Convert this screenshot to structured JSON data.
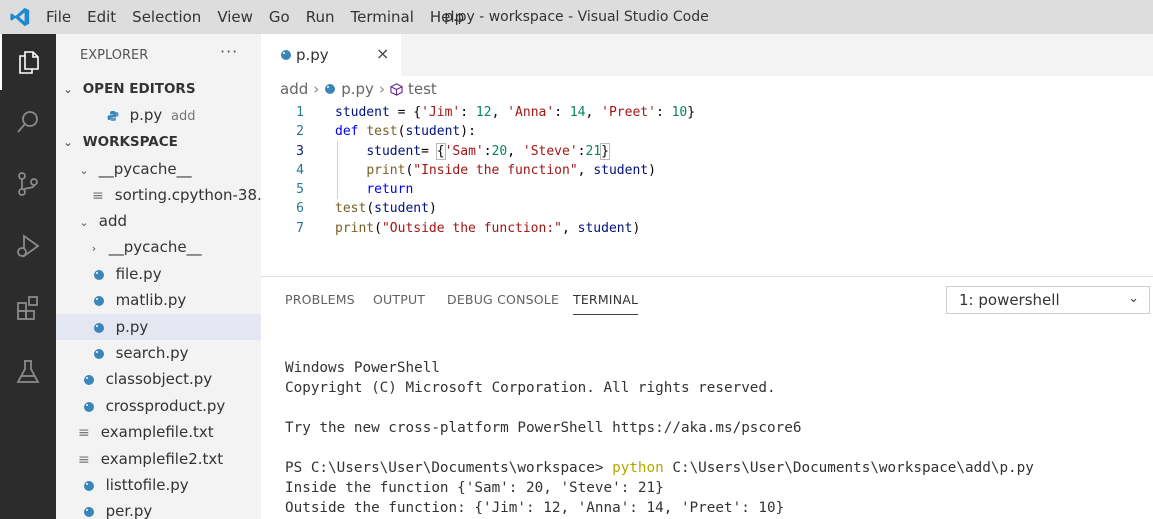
{
  "window": {
    "title": "p.py - workspace - Visual Studio Code"
  },
  "menu": [
    "File",
    "Edit",
    "Selection",
    "View",
    "Go",
    "Run",
    "Terminal",
    "Help"
  ],
  "explorer": {
    "title": "EXPLORER",
    "more": "···",
    "open_editors": {
      "label": "OPEN EDITORS",
      "file": "p.py",
      "folder": "add"
    },
    "workspace": {
      "label": "WORKSPACE",
      "items": [
        {
          "label": "__pycache__",
          "kind": "folder-open"
        },
        {
          "label": "sorting.cpython-38....",
          "kind": "text"
        },
        {
          "label": "add",
          "kind": "folder-open"
        },
        {
          "label": "__pycache__",
          "kind": "folder-closed"
        },
        {
          "label": "file.py",
          "kind": "python"
        },
        {
          "label": "matlib.py",
          "kind": "python"
        },
        {
          "label": "p.py",
          "kind": "python",
          "selected": true
        },
        {
          "label": "search.py",
          "kind": "python"
        },
        {
          "label": "classobject.py",
          "kind": "python"
        },
        {
          "label": "crossproduct.py",
          "kind": "python"
        },
        {
          "label": "examplefile.txt",
          "kind": "text"
        },
        {
          "label": "examplefile2.txt",
          "kind": "text"
        },
        {
          "label": "listtofile.py",
          "kind": "python"
        },
        {
          "label": "per.py",
          "kind": "python"
        }
      ]
    }
  },
  "editor": {
    "tab": "p.py",
    "close": "×",
    "breadcrumb": [
      "add",
      "p.py",
      "test"
    ],
    "line_numbers": [
      "1",
      "2",
      "3",
      "4",
      "5",
      "6",
      "7"
    ]
  },
  "panel": {
    "tabs": [
      "PROBLEMS",
      "OUTPUT",
      "DEBUG CONSOLE",
      "TERMINAL"
    ],
    "active_tab": "TERMINAL",
    "terminal_select": "1: powershell",
    "terminal": {
      "line1": "Windows PowerShell",
      "line2": "Copyright (C) Microsoft Corporation. All rights reserved.",
      "line3": "Try the new cross-platform PowerShell https://aka.ms/pscore6",
      "prompt": "PS C:\\Users\\User\\Documents\\workspace> ",
      "command": "python",
      "args": " C:\\Users\\User\\Documents\\workspace\\add\\p.py",
      "out1": "Inside the function {'Sam': 20, 'Steve': 21}",
      "out2": "Outside the function: {'Jim': 12, 'Anna': 14, 'Preet': 10}"
    }
  },
  "colors": {
    "activity_bar": "#2c2c2c",
    "sidebar": "#f3f3f3",
    "titlebar": "#dddddd",
    "accent": "#007acc"
  }
}
